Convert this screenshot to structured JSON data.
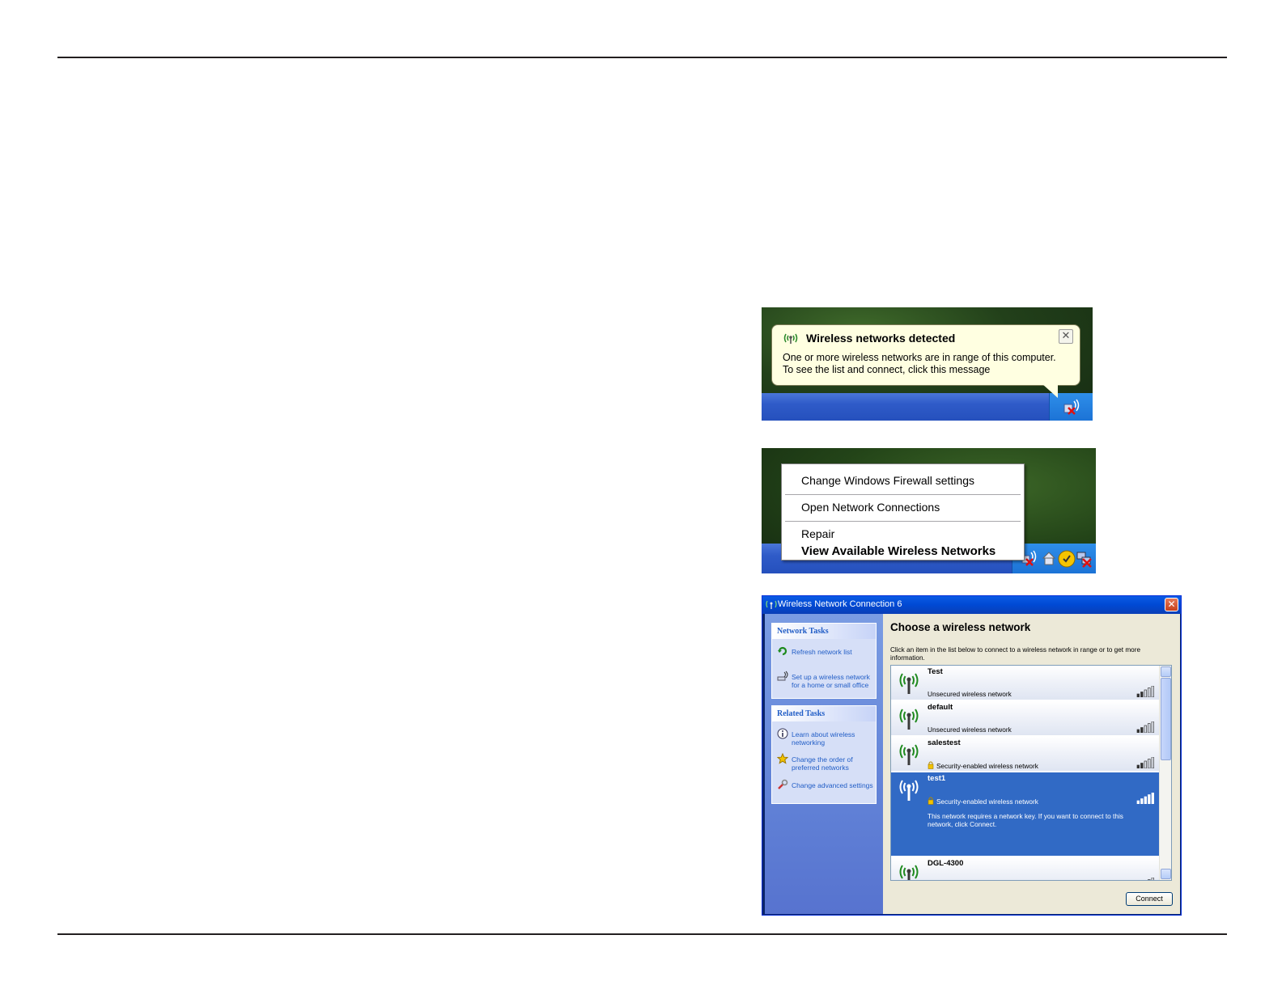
{
  "balloon": {
    "title": "Wireless networks detected",
    "close_glyph": "✕",
    "line1": "One or more wireless networks are in range of this computer.",
    "line2": "To see the list and connect, click this message",
    "icon": "wireless-icon"
  },
  "context_menu": {
    "items": [
      "Change Windows Firewall settings",
      "Open Network Connections",
      "Repair",
      "View Available Wireless Networks"
    ]
  },
  "wnc": {
    "title": "Wireless Network Connection 6",
    "close_glyph": "✕",
    "network_tasks": {
      "header": "Network Tasks",
      "links": [
        "Refresh network list",
        "Set up a wireless network for a home or small office"
      ]
    },
    "related_tasks": {
      "header": "Related Tasks",
      "links": [
        "Learn about wireless networking",
        "Change the order of preferred networks",
        "Change advanced settings"
      ]
    },
    "heading": "Choose a wireless network",
    "description": "Click an item in the list below to connect to a wireless network in range or to get more information.",
    "networks": [
      {
        "name": "Test",
        "status": "Unsecured wireless network",
        "secured": false
      },
      {
        "name": "default",
        "status": "Unsecured wireless network",
        "secured": false
      },
      {
        "name": "salestest",
        "status": "Security-enabled wireless network",
        "secured": true
      },
      {
        "name": "test1",
        "status": "Security-enabled wireless network",
        "secured": true,
        "detail": "This network requires a network key. If you want to connect to this network, click Connect."
      },
      {
        "name": "DGL-4300",
        "status": "",
        "secured": false
      }
    ],
    "connect_label": "Connect"
  },
  "colors": {
    "xp_blue": "#2550bd",
    "selection": "#316ac5",
    "balloon_bg": "#ffffe1",
    "link": "#215dc6"
  }
}
